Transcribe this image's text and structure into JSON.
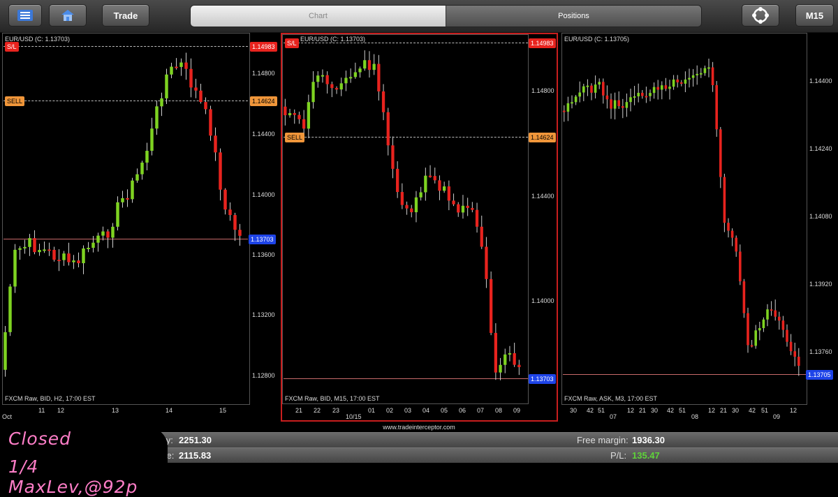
{
  "toolbar": {
    "menu_icon": "menu-icon",
    "home_icon": "home-icon",
    "trade_label": "Trade",
    "chart_tab": "Chart",
    "positions_tab": "Positions",
    "refresh_icon": "refresh-icon",
    "timeframe_label": "M15"
  },
  "colors": {
    "bull": "#7ed321",
    "bear": "#e8231e",
    "panel_border": "#c81e1e"
  },
  "panels": [
    {
      "title": "EUR/USD (C: 1.13703)",
      "footer": "FXCM Raw, BID, H2, 17:00 EST",
      "sl_tag": "S/L",
      "sl_price": "1.14983",
      "sell_tag": "SELL",
      "sell_price": "1.14624",
      "current_price": "1.13703",
      "y_ticks": [
        "1.14800",
        "1.14400",
        "1.14000",
        "1.13600",
        "1.13200",
        "1.12800"
      ],
      "x_ticks": [
        "11",
        "12",
        "13",
        "14",
        "15"
      ],
      "x_sublabel": "Oct"
    },
    {
      "title": "EUR/USD (C: 1.13703)",
      "footer": "FXCM Raw, BID, M15, 17:00 EST",
      "sl_tag": "S/L",
      "sl_price": "1.14983",
      "sell_tag": "SELL",
      "sell_price": "1.14624",
      "current_price": "1.13703",
      "y_ticks": [
        "1.14800",
        "1.14400",
        "1.14000"
      ],
      "x_ticks": [
        "21",
        "22",
        "23",
        "01",
        "02",
        "03",
        "04",
        "05",
        "06",
        "07",
        "08",
        "09"
      ],
      "x_sublabel": "10/15"
    },
    {
      "title": "EUR/USD (C: 1.13705)",
      "footer": "FXCM Raw, ASK, M3, 17:00 EST",
      "current_price": "1.13705",
      "y_ticks": [
        "1.14400",
        "1.14240",
        "1.14080",
        "1.13920",
        "1.13760"
      ],
      "x_ticks": [
        "30",
        "42",
        "51",
        "12",
        "21",
        "30",
        "42",
        "51",
        "12",
        "21",
        "30",
        "42",
        "51",
        "12"
      ],
      "x_sublabels": [
        "07",
        "08",
        "09"
      ]
    }
  ],
  "website": "www.tradeinterceptor.com",
  "account": {
    "equity_label": "uity:",
    "equity_value": "2251.30",
    "free_margin_label": "Free margin:",
    "free_margin_value": "1936.30",
    "balance_label": "ce:",
    "balance_value": "2115.83",
    "pl_label": "P/L:",
    "pl_value": "135.47"
  },
  "note": {
    "line1": "Closed",
    "line2": "1/4 MaxLev,@92p"
  }
}
